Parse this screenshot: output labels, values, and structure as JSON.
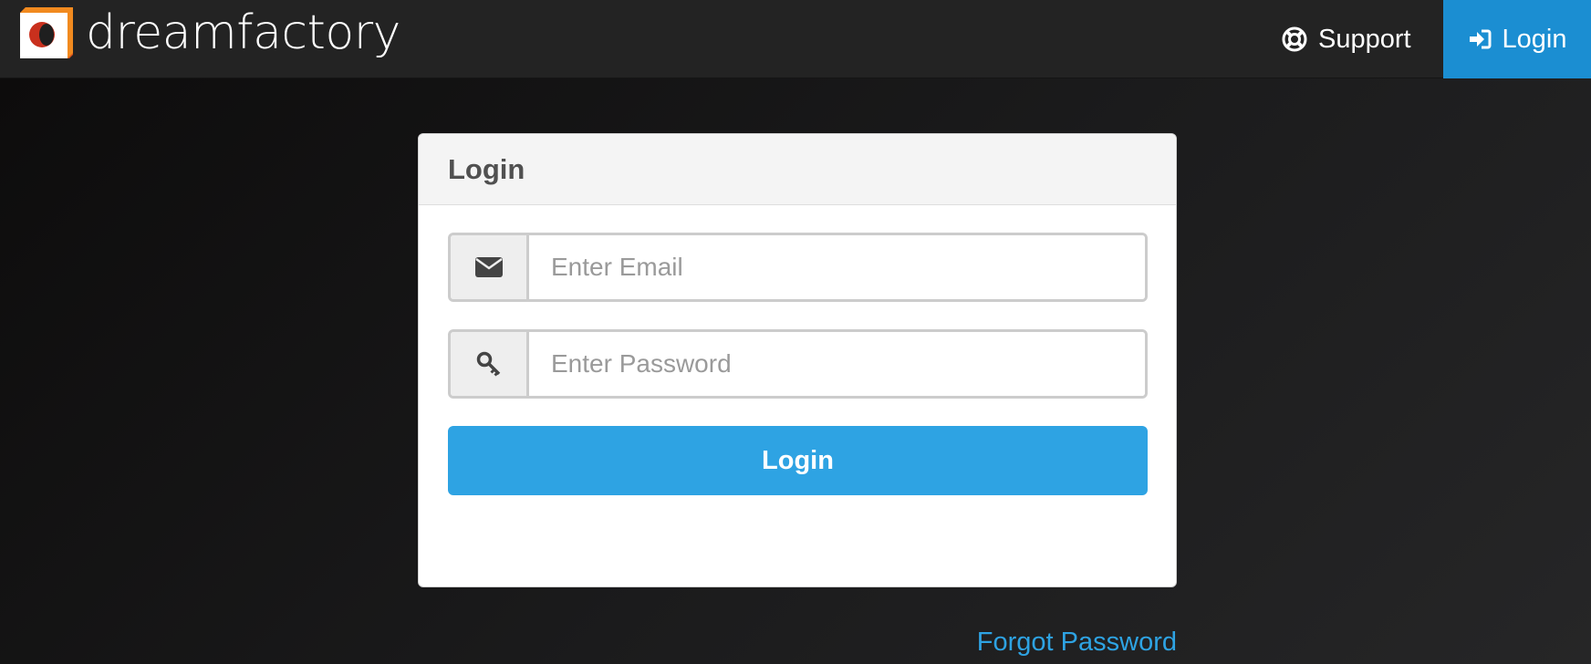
{
  "brand": {
    "name": "dreamfactory",
    "logo_icon": "dreamfactory-logo-icon"
  },
  "nav": {
    "support_label": "Support",
    "support_icon": "lifebuoy-icon",
    "login_label": "Login",
    "login_icon": "sign-in-icon"
  },
  "panel": {
    "title": "Login",
    "email": {
      "icon": "envelope-icon",
      "placeholder": "Enter Email",
      "value": ""
    },
    "password": {
      "icon": "key-icon",
      "placeholder": "Enter Password",
      "value": ""
    },
    "submit_label": "Login"
  },
  "forgot_password_label": "Forgot Password",
  "colors": {
    "navbar": "#232323",
    "nav_login_bg": "#1b8ed2",
    "primary_button": "#2ea3e3",
    "link": "#2ea3e3",
    "logo_orange": "#f18a1f",
    "logo_red": "#c9301d"
  }
}
